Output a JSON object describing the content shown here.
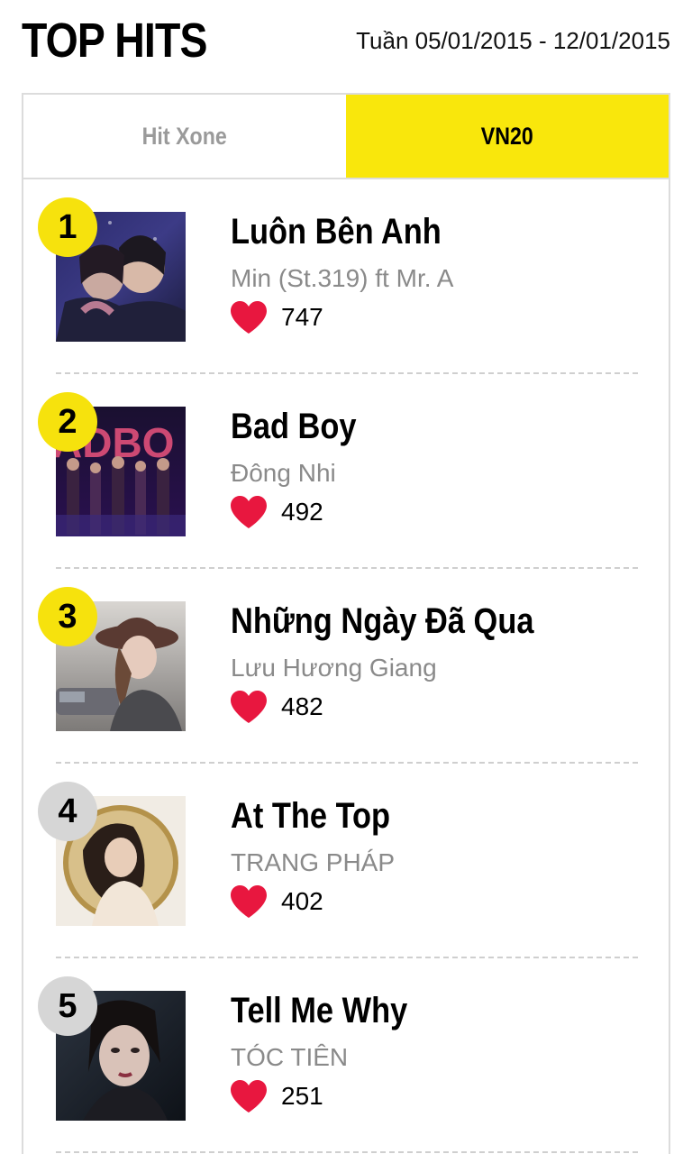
{
  "header": {
    "title": "TOP HITS",
    "week": "Tuần 05/01/2015 - 12/01/2015"
  },
  "tabs": [
    {
      "label": "Hit Xone",
      "active": false
    },
    {
      "label": "VN20",
      "active": true
    }
  ],
  "colors": {
    "accent": "#f9e70c",
    "heart": "#e8173f",
    "rank_badge_top": "#f6e20d",
    "rank_badge_rest": "#d6d6d6",
    "artist_text": "#8a8a8a"
  },
  "songs": [
    {
      "rank": "1",
      "title": "Luôn Bên Anh",
      "artist": "Min (St.319) ft Mr. A",
      "likes": "747",
      "cover": "album-cover-image"
    },
    {
      "rank": "2",
      "title": "Bad Boy",
      "artist": "Đông Nhi",
      "likes": "492",
      "cover": "album-cover-image"
    },
    {
      "rank": "3",
      "title": "Những Ngày Đã Qua",
      "artist": "Lưu Hương Giang",
      "likes": "482",
      "cover": "album-cover-image"
    },
    {
      "rank": "4",
      "title": "At The Top",
      "artist": "TRANG PHÁP",
      "likes": "402",
      "cover": "album-cover-image"
    },
    {
      "rank": "5",
      "title": "Tell Me Why",
      "artist": "TÓC TIÊN",
      "likes": "251",
      "cover": "album-cover-image"
    }
  ],
  "icons": {
    "like": "heart-icon"
  }
}
